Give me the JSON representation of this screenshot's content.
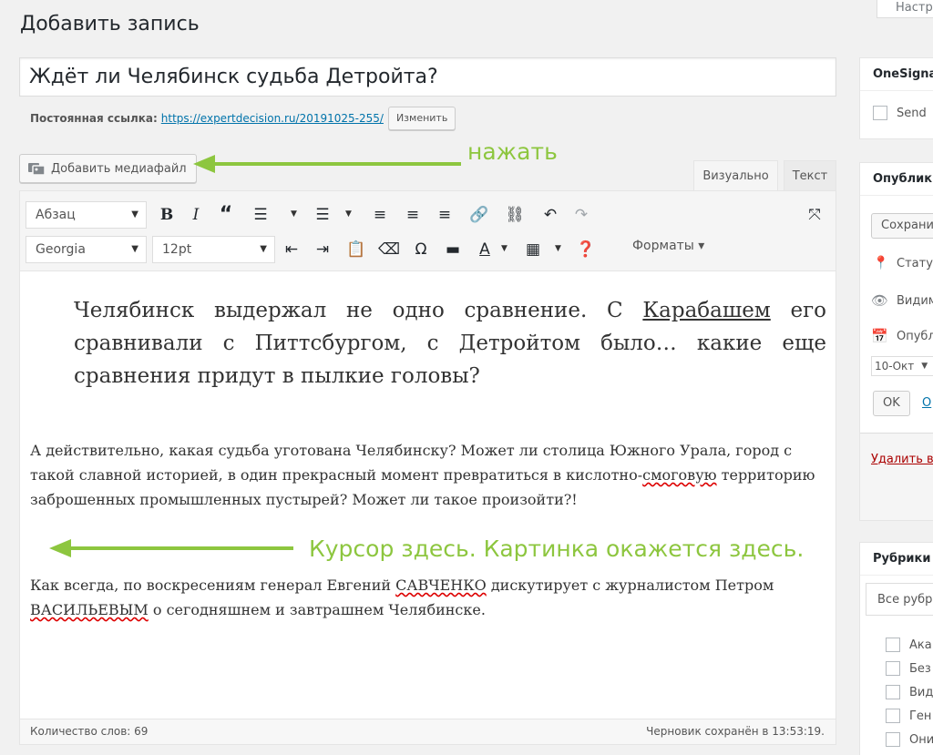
{
  "header": {
    "page_title": "Добавить запись",
    "screen_options": "Настр"
  },
  "post": {
    "title": "Ждёт ли Челябинск судьба Детройта?",
    "permalink_label": "Постоянная ссылка:",
    "permalink_url": "https://expertdecision.ru/20191025-255/",
    "change_button": "Изменить"
  },
  "media": {
    "add_media_label": "Добавить медиафайл"
  },
  "annotations": {
    "press": "нажать",
    "cursor_note": "Курсор здесь. Картинка окажется здесь."
  },
  "editor": {
    "tab_visual": "Визуально",
    "tab_text": "Текст",
    "format_select": "Абзац",
    "font_select": "Georgia",
    "size_select": "12pt",
    "formats_menu": "Форматы",
    "word_count": "Количество слов: 69",
    "draft_saved": "Черновик сохранён в 13:53:19."
  },
  "content": {
    "quote_a": "Челябинск выдержал не одно сравнение. С ",
    "quote_link": "Карабашем",
    "quote_b": " его сравнивали с Питтсбургом, с Детройтом было… какие еще сравнения придут в пылкие головы?",
    "p1_a": "А действительно, какая судьба уготована Челябинску? Может ли столица Южного Урала, город с такой славной историей, в один прекрасный момент превратиться в кислотно-",
    "p1_spell": "смоговую",
    "p1_b": " территорию заброшенных промышленных пустырей? Может ли такое произойти?!",
    "p2_a": "Как всегда, по воскресениям генерал Евгений ",
    "p2_spell1": "САВЧЕНКО",
    "p2_b": " дискутирует с журналистом Петром ",
    "p2_spell2": "ВАСИЛЬЕВЫМ",
    "p2_c": " о сегодняшнем и завтрашнем Челябинске."
  },
  "sidebar": {
    "onesignal_title": "OneSigna",
    "onesignal_send": "Send",
    "publish_title": "Опублик",
    "save_button": "Сохрани",
    "status_label": "Статус",
    "visibility_label": "Видим",
    "publish_date_label": "Опубл",
    "month_select": "10-Окт",
    "ok_button": "OK",
    "cancel_link": "О",
    "delete_link": "Удалить в",
    "categories_title": "Рубрики",
    "all_categories_tab": "Все рубр",
    "categories": [
      "Ака",
      "Без",
      "Вид",
      "Ген",
      "Они"
    ]
  },
  "colors": {
    "accent": "#0073aa",
    "annotation": "#8dc63f",
    "delete": "#a00"
  }
}
